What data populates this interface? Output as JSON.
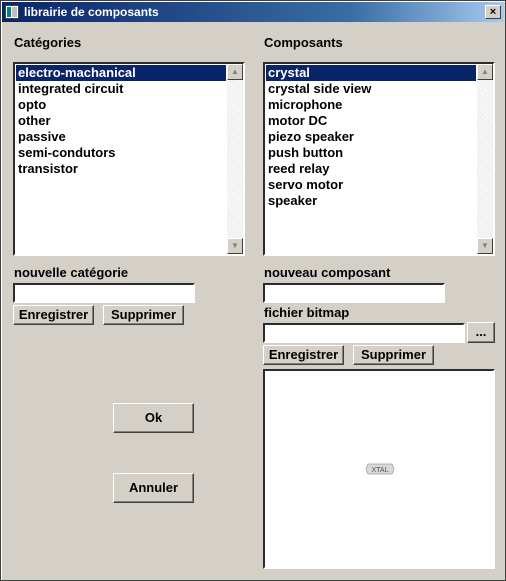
{
  "window": {
    "title": "librairie de composants",
    "close_glyph": "×"
  },
  "categories": {
    "heading": "Catégories",
    "items": [
      "electro-machanical",
      "integrated circuit",
      "opto",
      "other",
      "passive",
      "semi-condutors",
      "transistor"
    ],
    "selected_index": 0,
    "new_label": "nouvelle catégorie",
    "new_value": "",
    "save_label": "Enregistrer",
    "delete_label": "Supprimer"
  },
  "components": {
    "heading": "Composants",
    "items": [
      "crystal",
      "crystal side view",
      "microphone",
      "motor DC",
      "piezo speaker",
      "push button",
      "reed relay",
      "servo motor",
      "speaker"
    ],
    "selected_index": 0,
    "new_label": "nouveau composant",
    "new_value": "",
    "bitmap_label": "fichier bitmap",
    "bitmap_value": "",
    "browse_label": "...",
    "save_label": "Enregistrer",
    "delete_label": "Supprimer",
    "preview_text": "XTAL"
  },
  "dialog": {
    "ok_label": "Ok",
    "cancel_label": "Annuler"
  },
  "icons": {
    "scroll_up": "▲",
    "scroll_down": "▼"
  }
}
